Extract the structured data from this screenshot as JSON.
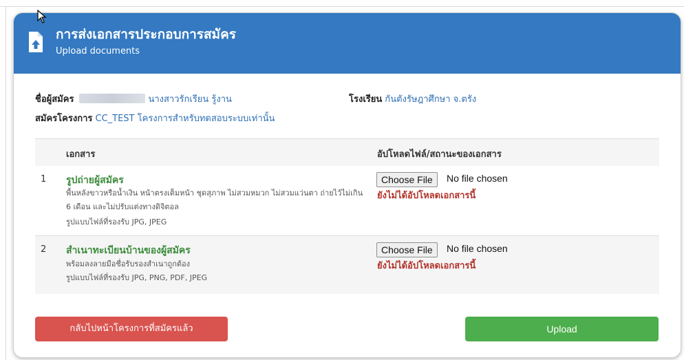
{
  "header": {
    "title": "การส่งเอกสารประกอบการสมัคร",
    "subtitle": "Upload documents"
  },
  "applicant": {
    "name_label": "ชื่อผู้สมัคร",
    "name_value": "นางสาวรักเรียน รู้งาน",
    "school_label": "โรงเรียน",
    "school_value": "กันตังรัษฎาศึกษา จ.ตรัง",
    "project_label": "สมัครโครงการ",
    "project_value": "CC_TEST โครงการสำหรับทดสอบระบบเท่านั้น"
  },
  "table": {
    "headers": {
      "document": "เอกสาร",
      "status": "อัปโหลดไฟล์/สถานะของเอกสาร"
    },
    "rows": [
      {
        "index": "1",
        "title": "รูปถ่ายผู้สมัคร",
        "desc_line1": "พื้นหลังขาวหรือน้ำเงิน หน้าตรงเต็มหน้า ชุดสุภาพ ไม่สวมหมวก ไม่สวมแว่นตา ถ่ายไว้ไม่เกิน 6 เดือน และไม่ปรับแต่งทางดิจิตอล",
        "desc_formats": "รูปแบบไฟล์ที่รองรับ JPG, JPEG",
        "choose_label": "Choose File",
        "file_status": "No file chosen",
        "upload_status": "ยังไม่ได้อัปโหลดเอกสารนี้"
      },
      {
        "index": "2",
        "title": "สำเนาทะเบียนบ้านของผู้สมัคร",
        "desc_line1": "พร้อมลงลายมือชื่อรับรองสำเนาถูกต้อง",
        "desc_formats": "รูปแบบไฟล์ที่รองรับ JPG, PNG, PDF, JPEG",
        "choose_label": "Choose File",
        "file_status": "No file chosen",
        "upload_status": "ยังไม่ได้อัปโหลดเอกสารนี้"
      }
    ]
  },
  "actions": {
    "back_label": "กลับไปหน้าโครงการที่สมัครแล้ว",
    "upload_label": "Upload"
  },
  "colors": {
    "header_bg": "#3479c1",
    "doc_title": "#3c8b3c",
    "link": "#2f6fb3",
    "not_uploaded": "#b3332b",
    "back_button": "#d9534f",
    "upload_button": "#4cae4c"
  },
  "icons": {
    "header": "file-upload-icon",
    "cursor": "mouse-cursor-icon"
  }
}
